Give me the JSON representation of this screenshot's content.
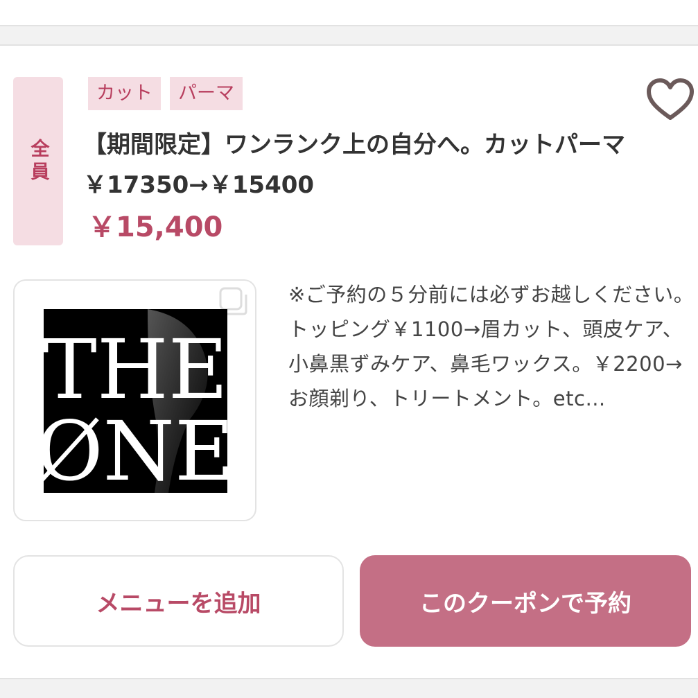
{
  "coupon": {
    "target_label": "全員",
    "tags": [
      "カット",
      "パーマ"
    ],
    "title": "【期間限定】ワンランク上の自分へ。カットパーマ￥17350→￥15400",
    "price": "￥15,400",
    "description": "※ご予約の５分前には必ずお越しください。トッピング￥1100→眉カット、頭皮ケア、小鼻黒ずみケア、鼻毛ワックス。￥2200→お顔剃り、トリートメント。etc…",
    "image_text": {
      "line1": "THE",
      "line2": "ØNE"
    },
    "favorite_icon": "heart-icon",
    "gallery_icon": "copy-icon"
  },
  "actions": {
    "add_menu_label": "メニューを追加",
    "book_label": "このクーポンで予約"
  },
  "colors": {
    "accent": "#b84a66",
    "tag_bg": "#f5dde3",
    "button_primary": "#c46f85"
  }
}
